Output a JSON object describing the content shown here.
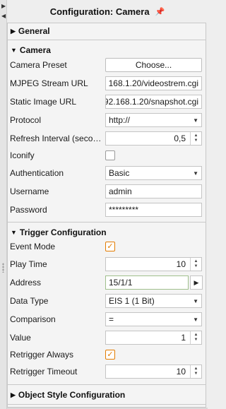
{
  "header": {
    "title": "Configuration: Camera",
    "pin_glyph": "📌"
  },
  "sections": {
    "general": "General",
    "camera": "Camera",
    "trigger": "Trigger Configuration",
    "object_style": "Object Style Configuration"
  },
  "camera": {
    "preset_label": "Camera Preset",
    "preset_button": "Choose...",
    "mjpeg_label": "MJPEG Stream URL",
    "mjpeg_value": "168.1.20/videostrem.cgi",
    "static_label": "Static Image URL",
    "static_value": "92.168.1.20/snapshot.cgi",
    "protocol_label": "Protocol",
    "protocol_value": "http://",
    "refresh_label": "Refresh Interval (secon...",
    "refresh_value": "0,5",
    "iconify_label": "Iconify",
    "iconify_checked": false,
    "auth_label": "Authentication",
    "auth_value": "Basic",
    "username_label": "Username",
    "username_value": "admin",
    "password_label": "Password",
    "password_value": "*********"
  },
  "trigger": {
    "event_mode_label": "Event Mode",
    "event_mode_checked": true,
    "play_time_label": "Play Time",
    "play_time_value": "10",
    "address_label": "Address",
    "address_value": "15/1/1",
    "data_type_label": "Data Type",
    "data_type_value": "EIS 1 (1 Bit)",
    "comparison_label": "Comparison",
    "comparison_value": "=",
    "value_label": "Value",
    "value_value": "1",
    "retrigger_always_label": "Retrigger Always",
    "retrigger_always_checked": true,
    "retrigger_timeout_label": "Retrigger Timeout",
    "retrigger_timeout_value": "10"
  },
  "colors": {
    "accent": "#e37b00",
    "address_border": "#9fbf8c"
  },
  "icons": {
    "collapsed": "triangle-right-icon",
    "expanded": "triangle-down-icon",
    "pin": "pin-icon",
    "check": "checkmark-icon"
  }
}
